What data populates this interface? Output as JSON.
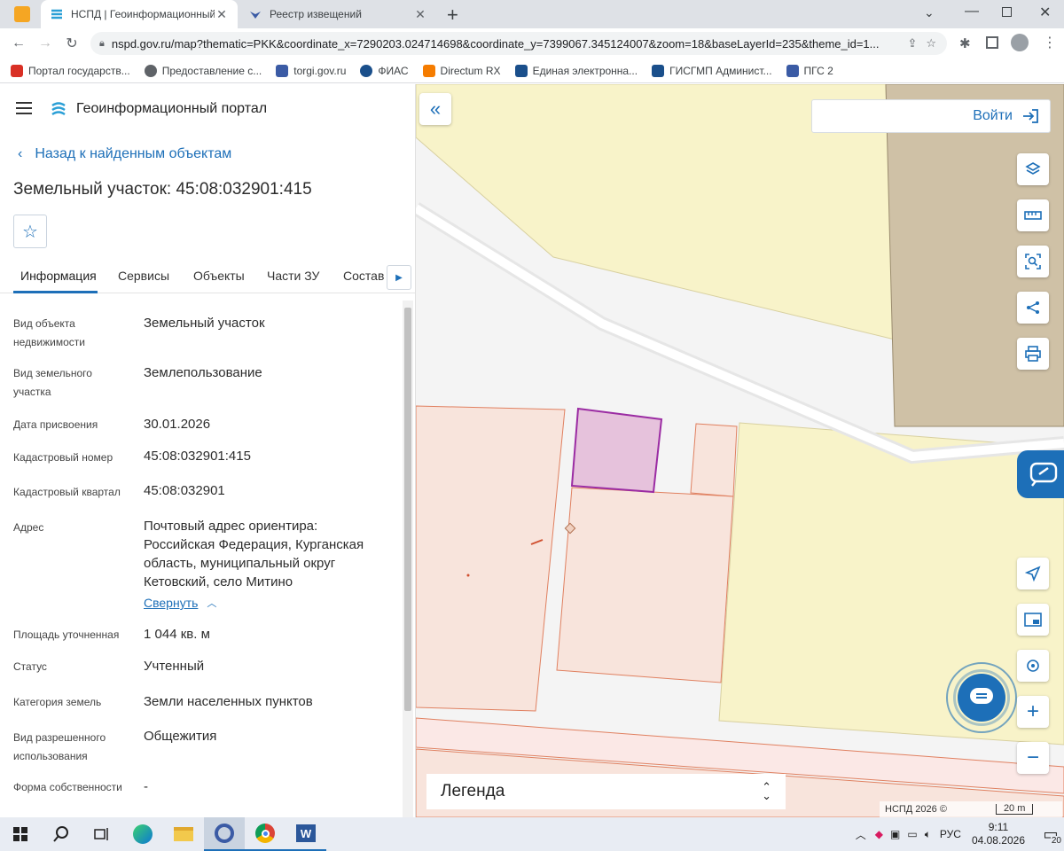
{
  "browser": {
    "tabs": [
      {
        "title": "НСПД | Геоинформационный п",
        "active": true
      },
      {
        "title": "Реестр извещений",
        "active": false
      }
    ],
    "url": "nspd.gov.ru/map?thematic=PKK&coordinate_x=7290203.024714698&coordinate_y=7399067.345124007&zoom=18&baseLayerId=235&theme_id=1...",
    "bookmarks": [
      {
        "label": "Портал государств...",
        "color": "#d93025"
      },
      {
        "label": "Предоставление с...",
        "color": "#5f6368"
      },
      {
        "label": "torgi.gov.ru",
        "color": "#3b5ba5"
      },
      {
        "label": "ФИАС",
        "color": "#1a4f8b"
      },
      {
        "label": "Directum RX",
        "color": "#f57c00"
      },
      {
        "label": "Единая электронна...",
        "color": "#1a4f8b"
      },
      {
        "label": "ГИСГМП Админист...",
        "color": "#1a4f8b"
      },
      {
        "label": "ПГС 2",
        "color": "#3b5ba5"
      }
    ]
  },
  "portal": {
    "name": "Геоинформационный портал",
    "back_label": "Назад к найденным объектам",
    "title": "Земельный участок: 45:08:032901:415",
    "tabs": [
      "Информация",
      "Сервисы",
      "Объекты",
      "Части ЗУ",
      "Состав"
    ],
    "fields": [
      {
        "label": "Вид объекта недвижимости",
        "value": "Земельный участок"
      },
      {
        "label": "Вид земельного участка",
        "value": "Землепользование"
      },
      {
        "label": "Дата присвоения",
        "value": "30.01.2026"
      },
      {
        "label": "Кадастровый номер",
        "value": "45:08:032901:415"
      },
      {
        "label": "Кадастровый квартал",
        "value": "45:08:032901"
      },
      {
        "label": "Адрес",
        "value": "Почтовый адрес ориентира: Российская Федерация, Курганская область, муниципальный округ Кетовский, село Митино"
      },
      {
        "label": "Площадь уточненная",
        "value": "1 044 кв. м"
      },
      {
        "label": "Статус",
        "value": "Учтенный"
      },
      {
        "label": "Категория земель",
        "value": "Земли населенных пунктов"
      },
      {
        "label": "Вид разрешенного использования",
        "value": "Общежития"
      },
      {
        "label": "Форма собственности",
        "value": "-"
      }
    ],
    "collapse_label": "Свернуть"
  },
  "map": {
    "login_label": "Войти",
    "legend_label": "Легенда",
    "copyright": "НСПД 2026 ©",
    "scale": "20 m",
    "colors": {
      "yellow": "#f8f3c9",
      "brown": "#cfc1a6",
      "parcel_fill": "#f8e4dc",
      "parcel_stroke": "#e08060",
      "selected": "#9b2ca3",
      "accent": "#1d6fb8"
    }
  },
  "taskbar": {
    "lang": "РУС",
    "time": "9:11",
    "date": "04.08.2026",
    "notifications": "20"
  }
}
